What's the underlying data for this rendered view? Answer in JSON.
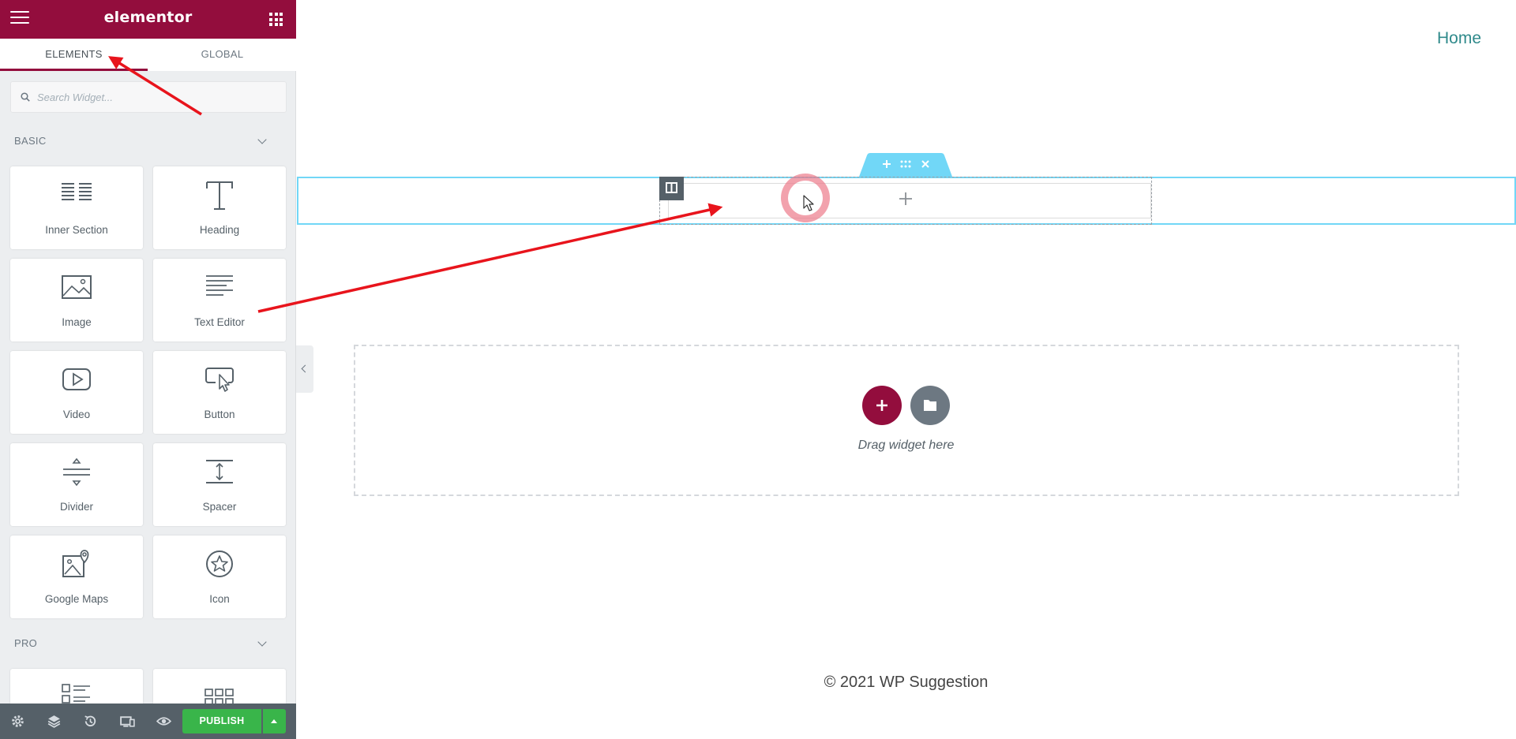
{
  "editor": {
    "logo": "elementor",
    "tabs": [
      {
        "label": "ELEMENTS",
        "active": true
      },
      {
        "label": "GLOBAL",
        "active": false
      }
    ],
    "search": {
      "placeholder": "Search Widget...",
      "value": ""
    },
    "categories": [
      {
        "label": "BASIC",
        "widgets": [
          {
            "label": "Inner Section",
            "icon": "inner-section-icon"
          },
          {
            "label": "Heading",
            "icon": "heading-icon"
          },
          {
            "label": "Image",
            "icon": "image-icon"
          },
          {
            "label": "Text Editor",
            "icon": "text-editor-icon"
          },
          {
            "label": "Video",
            "icon": "video-icon"
          },
          {
            "label": "Button",
            "icon": "button-icon"
          },
          {
            "label": "Divider",
            "icon": "divider-icon"
          },
          {
            "label": "Spacer",
            "icon": "spacer-icon"
          },
          {
            "label": "Google Maps",
            "icon": "google-maps-icon"
          },
          {
            "label": "Icon",
            "icon": "star-icon"
          }
        ]
      },
      {
        "label": "PRO"
      }
    ],
    "footer": {
      "publish_label": "PUBLISH"
    },
    "colors": {
      "brand": "#930d3d",
      "publish": "#39b54a",
      "section_outline": "#71d7f7",
      "annotation_arrow": "#e8141c"
    }
  },
  "page": {
    "nav": {
      "home_label": "Home"
    },
    "dropzone": {
      "text": "Drag widget here"
    },
    "footer": {
      "copyright": "© 2021 WP Suggestion"
    }
  }
}
